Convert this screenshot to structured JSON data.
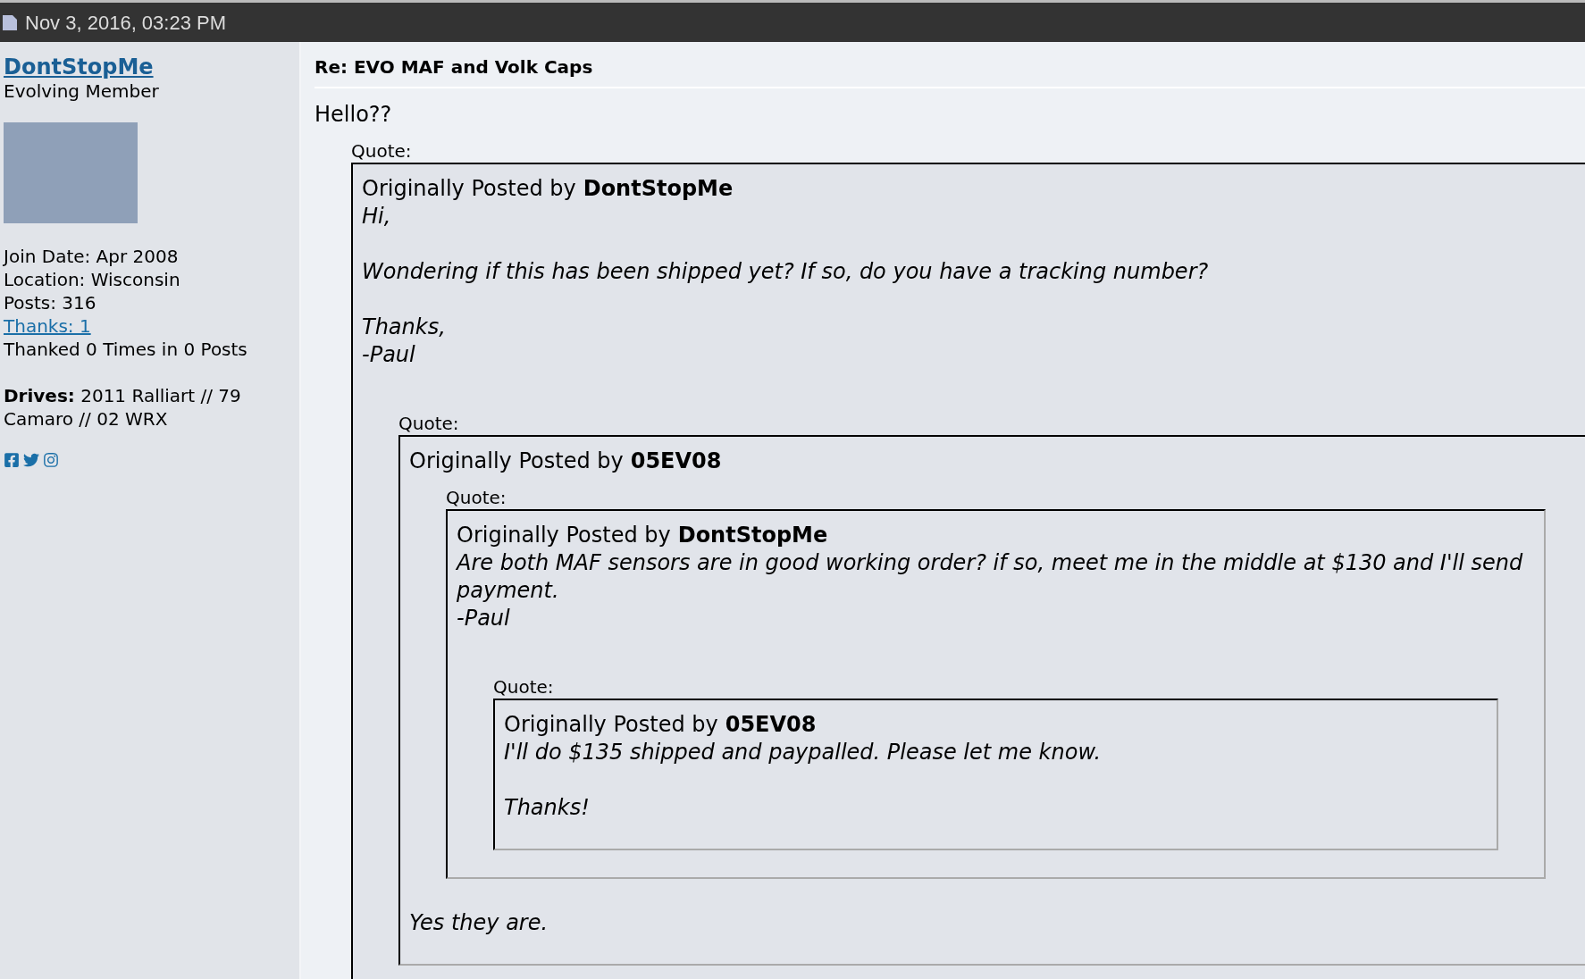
{
  "header": {
    "date": "Nov 3, 2016, 03:23 PM"
  },
  "user": {
    "name": "DontStopMe",
    "rank": "Evolving Member",
    "stats": [
      {
        "kind": "text",
        "text": "Join Date: Apr 2008"
      },
      {
        "kind": "text",
        "text": "Location: Wisconsin"
      },
      {
        "kind": "text",
        "text": "Posts: 316"
      },
      {
        "kind": "link",
        "text": "Thanks: 1"
      },
      {
        "kind": "text",
        "text": "Thanked 0 Times in 0 Posts"
      }
    ],
    "drives": "**Drives:** 2011 Ralliart // 79 Camaro // 02 WRX"
  },
  "post": {
    "title": "Re: EVO MAF and Volk Caps",
    "message": "Hello??",
    "quote": {
      "label": "Quote:",
      "byline": "Originally Posted by",
      "author": "DontStopMe",
      "before": [
        [
          "Hi,"
        ],
        [
          "Wondering if this has been shipped yet? If so, do you have a tracking number?"
        ],
        [
          "Thanks,",
          "-Paul"
        ]
      ],
      "quote": {
        "label": "Quote:",
        "byline": "Originally Posted by",
        "author": "05EV08",
        "quote": {
          "label": "Quote:",
          "byline": "Originally Posted by",
          "author": "DontStopMe",
          "before": [
            [
              "Are both MAF sensors are in good working order? if so, meet me in the middle at $130 and I'll send payment.",
              "-Paul"
            ]
          ],
          "quote": {
            "label": "Quote:",
            "byline": "Originally Posted by",
            "author": "05EV08",
            "before": [
              [
                "I'll do $135 shipped and paypalled. Please let me know."
              ],
              [
                "Thanks!"
              ]
            ]
          }
        },
        "after": [
          [
            "Yes they are."
          ]
        ]
      }
    }
  }
}
